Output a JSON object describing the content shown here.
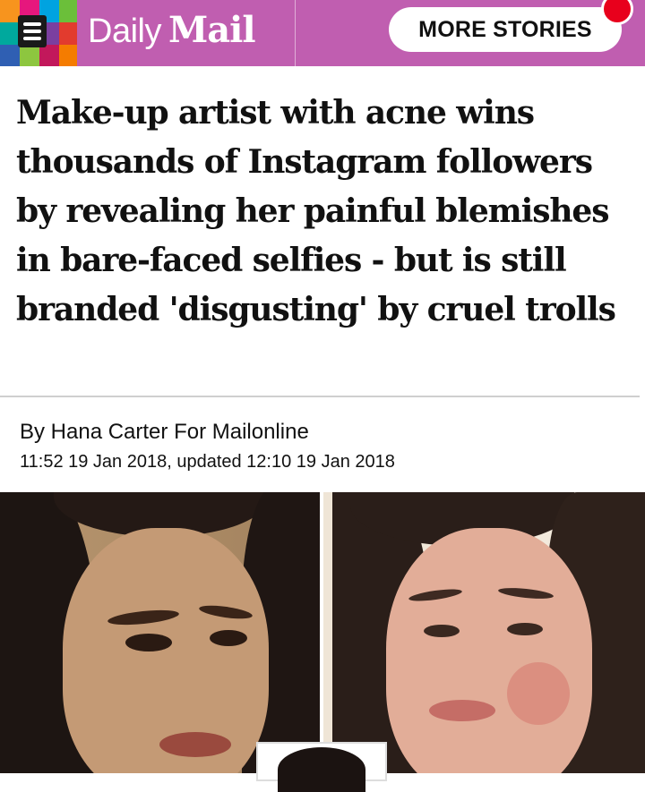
{
  "header": {
    "logo_daily": "Daily",
    "logo_mail": "Mail",
    "more_stories_label": "MORE STORIES",
    "menu_icon": "hamburger-menu-icon",
    "brand_color": "#c05eb0",
    "notification_color": "#e8001c"
  },
  "article": {
    "headline": "Make-up artist with acne wins thousands of Instagram followers by revealing her painful blemishes in bare-faced selfies - but is still branded 'disgusting' by cruel trolls",
    "byline": "By Hana Carter For Mailonline",
    "dateline": "11:52 19 Jan 2018, updated 12:10 19 Jan 2018"
  }
}
